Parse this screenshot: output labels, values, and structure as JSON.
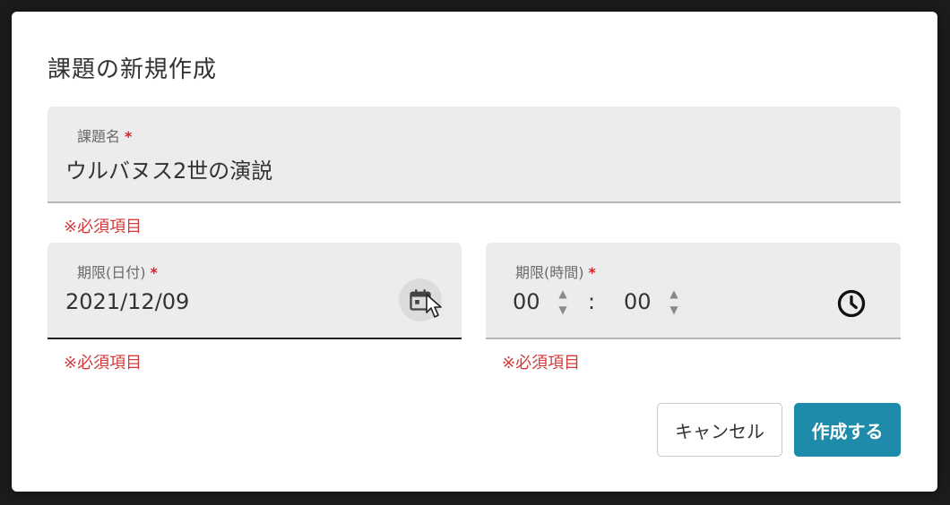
{
  "dialog": {
    "title": "課題の新規作成"
  },
  "title_field": {
    "label": "課題名",
    "required_mark": "*",
    "value": "ウルバヌス2世の演説",
    "error": "※必須項目"
  },
  "date_field": {
    "label": "期限(日付)",
    "required_mark": "*",
    "value": "2021/12/09",
    "error": "※必須項目",
    "icon": "calendar-icon"
  },
  "time_field": {
    "label": "期限(時間)",
    "required_mark": "*",
    "hour": "00",
    "minute": "00",
    "separator": ":",
    "error": "※必須項目",
    "icon": "clock-icon"
  },
  "buttons": {
    "cancel": "キャンセル",
    "create": "作成する"
  },
  "colors": {
    "primary": "#1f8bab",
    "error": "#d23a3a"
  }
}
